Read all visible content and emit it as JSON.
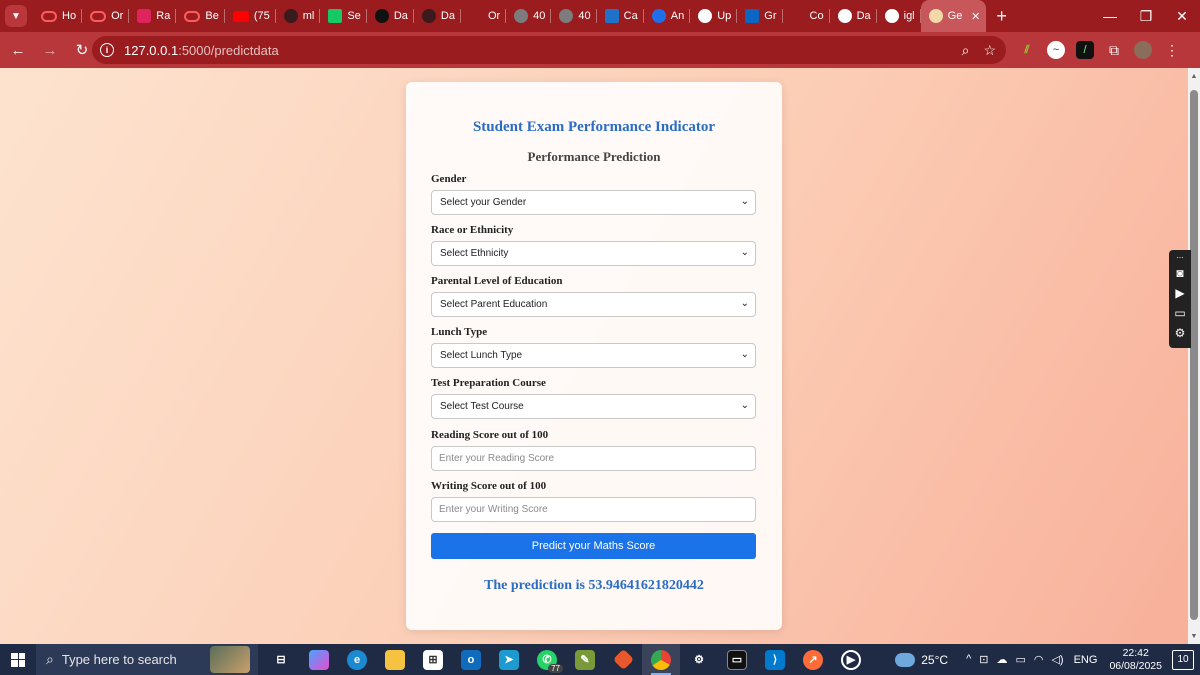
{
  "browser": {
    "tabs": [
      {
        "title": "Ho",
        "icon": "opera"
      },
      {
        "title": "Or",
        "icon": "opera"
      },
      {
        "title": "Ra",
        "icon": "red-sq"
      },
      {
        "title": "Be",
        "icon": "opera"
      },
      {
        "title": "(75",
        "icon": "youtube"
      },
      {
        "title": "ml",
        "icon": "dark"
      },
      {
        "title": "Se",
        "icon": "green-r"
      },
      {
        "title": "Da",
        "icon": "black"
      },
      {
        "title": "Da",
        "icon": "dark"
      },
      {
        "title": "Or",
        "icon": "gmail"
      },
      {
        "title": "40",
        "icon": "grey"
      },
      {
        "title": "40",
        "icon": "grey"
      },
      {
        "title": "Ca",
        "icon": "blue-play"
      },
      {
        "title": "An",
        "icon": "canva"
      },
      {
        "title": "Up",
        "icon": "upwork"
      },
      {
        "title": "Gr",
        "icon": "linkedin"
      },
      {
        "title": "Co",
        "icon": "col"
      },
      {
        "title": "Da",
        "icon": "white"
      },
      {
        "title": "igl",
        "icon": "google"
      },
      {
        "title": "Ge",
        "icon": "gem"
      }
    ],
    "url_host": "127.0.0.1",
    "url_path": ":5000/predictdata",
    "theme_color": "#b8373a"
  },
  "page": {
    "title": "Student Exam Performance Indicator",
    "subtitle": "Performance Prediction",
    "fields": {
      "gender": {
        "label": "Gender",
        "value": "Select your Gender"
      },
      "ethnicity": {
        "label": "Race or Ethnicity",
        "value": "Select Ethnicity"
      },
      "parent_education": {
        "label": "Parental Level of Education",
        "value": "Select Parent Education"
      },
      "lunch": {
        "label": "Lunch Type",
        "value": "Select Lunch Type"
      },
      "test_prep": {
        "label": "Test Preparation Course",
        "value": "Select Test Course"
      },
      "reading": {
        "label": "Reading Score out of 100",
        "placeholder": "Enter your Reading Score"
      },
      "writing": {
        "label": "Writing Score out of 100",
        "placeholder": "Enter your Writing Score"
      }
    },
    "submit_label": "Predict your Maths Score",
    "result": "The prediction is 53.94641621820442",
    "accent_color": "#1a73e8"
  },
  "taskbar": {
    "search_placeholder": "Type here to search",
    "whatsapp_badge": "77",
    "temperature": "25°C",
    "language": "ENG",
    "time": "22:42",
    "date": "06/08/2025",
    "notifications": "10"
  }
}
